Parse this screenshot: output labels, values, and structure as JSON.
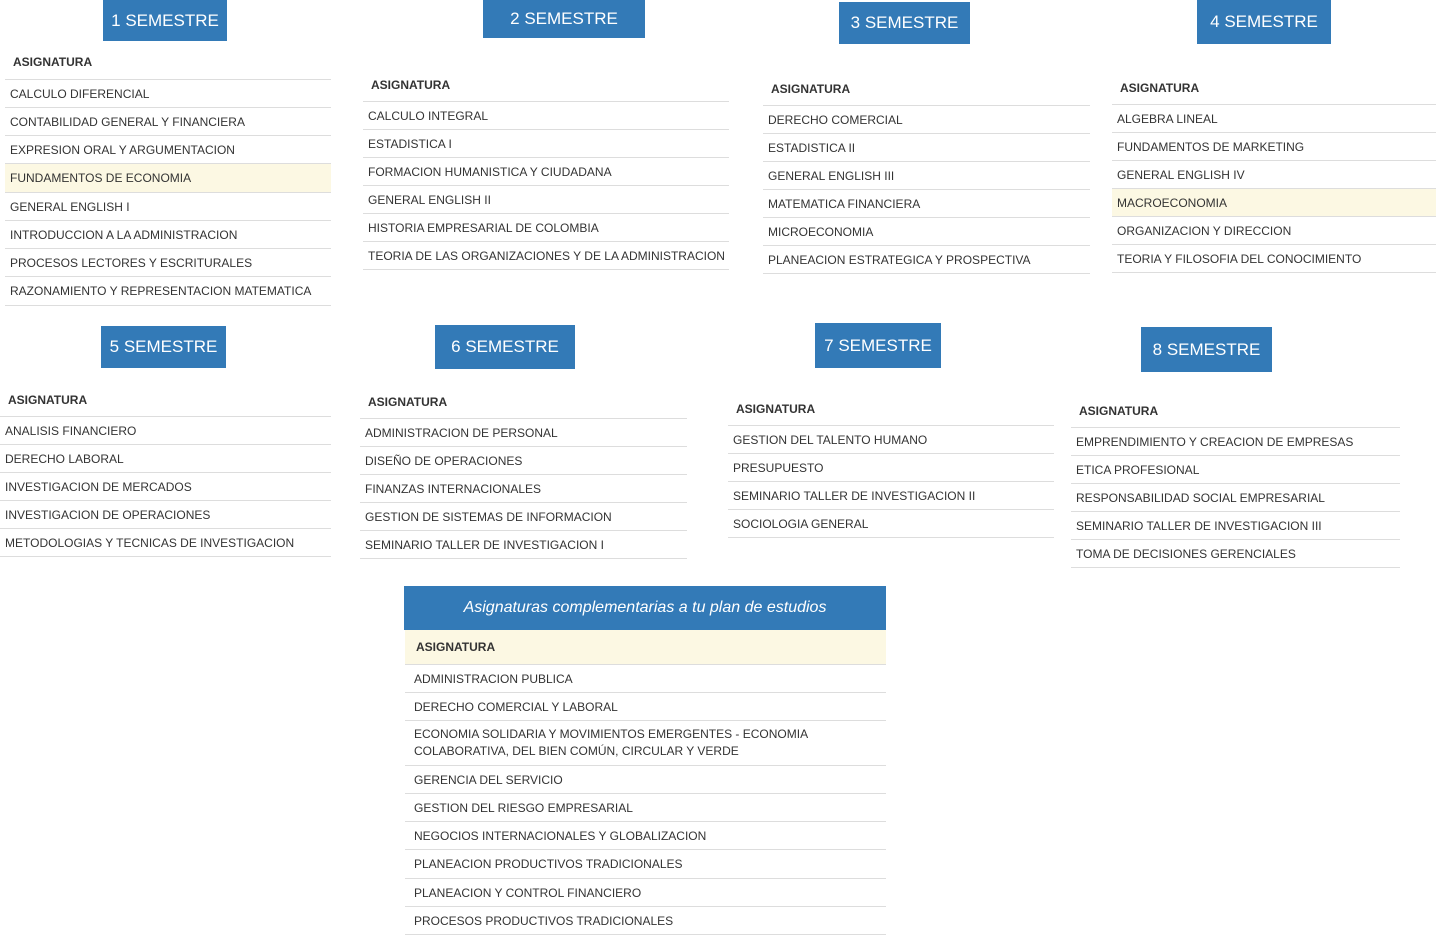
{
  "header_label": "ASIGNATURA",
  "semesters": [
    {
      "title": "1 SEMESTRE",
      "subjects": [
        "CALCULO DIFERENCIAL",
        "CONTABILIDAD GENERAL Y FINANCIERA",
        "EXPRESION ORAL Y ARGUMENTACION",
        "FUNDAMENTOS DE ECONOMIA",
        "GENERAL ENGLISH I",
        "INTRODUCCION A LA ADMINISTRACION",
        "PROCESOS LECTORES Y ESCRITURALES",
        "RAZONAMIENTO Y REPRESENTACION MATEMATICA"
      ]
    },
    {
      "title": "2 SEMESTRE",
      "subjects": [
        "CALCULO INTEGRAL",
        "ESTADISTICA I",
        "FORMACION HUMANISTICA Y CIUDADANA",
        "GENERAL ENGLISH II",
        "HISTORIA EMPRESARIAL DE COLOMBIA",
        "TEORIA DE LAS ORGANIZACIONES Y DE LA ADMINISTRACION"
      ]
    },
    {
      "title": "3 SEMESTRE",
      "subjects": [
        "DERECHO COMERCIAL",
        "ESTADISTICA II",
        "GENERAL ENGLISH III",
        "MATEMATICA FINANCIERA",
        "MICROECONOMIA",
        "PLANEACION ESTRATEGICA Y PROSPECTIVA"
      ]
    },
    {
      "title": "4 SEMESTRE",
      "subjects": [
        "ALGEBRA LINEAL",
        "FUNDAMENTOS DE MARKETING",
        "GENERAL ENGLISH IV",
        "MACROECONOMIA",
        "ORGANIZACION Y DIRECCION",
        "TEORIA Y FILOSOFIA DEL CONOCIMIENTO"
      ]
    },
    {
      "title": "5 SEMESTRE",
      "subjects": [
        "ANALISIS FINANCIERO",
        "DERECHO LABORAL",
        "INVESTIGACION DE MERCADOS",
        "INVESTIGACION DE OPERACIONES",
        "METODOLOGIAS Y TECNICAS DE INVESTIGACION"
      ]
    },
    {
      "title": "6 SEMESTRE",
      "subjects": [
        "ADMINISTRACION DE PERSONAL",
        "DISEÑO DE OPERACIONES",
        "FINANZAS INTERNACIONALES",
        "GESTION DE SISTEMAS DE INFORMACION",
        "SEMINARIO TALLER DE INVESTIGACION I"
      ]
    },
    {
      "title": "7 SEMESTRE",
      "subjects": [
        "GESTION DEL TALENTO HUMANO",
        "PRESUPUESTO",
        "SEMINARIO TALLER DE INVESTIGACION II",
        "SOCIOLOGIA GENERAL"
      ]
    },
    {
      "title": "8 SEMESTRE",
      "subjects": [
        "EMPRENDIMIENTO Y CREACION DE EMPRESAS",
        "ETICA PROFESIONAL",
        "RESPONSABILIDAD SOCIAL EMPRESARIAL",
        "SEMINARIO TALLER DE INVESTIGACION III",
        "TOMA DE DECISIONES GERENCIALES"
      ]
    }
  ],
  "complementary": {
    "title": "Asignaturas complementarias a tu plan de estudios",
    "header_label": "ASIGNATURA",
    "subjects": [
      "ADMINISTRACION PUBLICA",
      "DERECHO COMERCIAL Y LABORAL",
      "ECONOMIA SOLIDARIA Y MOVIMIENTOS EMERGENTES - ECONOMIA",
      "COLABORATIVA, DEL BIEN COMÚN, CIRCULAR Y VERDE",
      "GERENCIA DEL SERVICIO",
      "GESTION DEL RIESGO EMPRESARIAL",
      "NEGOCIOS INTERNACIONALES Y GLOBALIZACION",
      "PLANEACION PRODUCTIVOS TRADICIONALES",
      "PLANEACION Y CONTROL FINANCIERO",
      "PROCESOS PRODUCTIVOS TRADICIONALES"
    ]
  },
  "colors": {
    "primary": "#337ab7",
    "highlight": "#fcf8e3"
  }
}
